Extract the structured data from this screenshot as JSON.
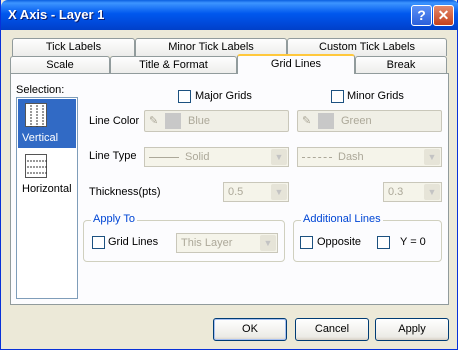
{
  "window": {
    "title": "X Axis - Layer 1",
    "help_label": "?",
    "close_label": "✕"
  },
  "tabs_row1": [
    "Tick Labels",
    "Minor Tick Labels",
    "Custom Tick Labels"
  ],
  "tabs_row2": [
    "Scale",
    "Title & Format",
    "Grid Lines",
    "Break"
  ],
  "active_tab": "Grid Lines",
  "selection": {
    "label": "Selection:",
    "items": [
      {
        "label": "Vertical",
        "selected": true
      },
      {
        "label": "Horizontal",
        "selected": false
      }
    ]
  },
  "grid": {
    "major_label": "Major Grids",
    "minor_label": "Minor Grids",
    "major_checked": false,
    "minor_checked": false,
    "line_color_label": "Line Color",
    "major_color": "Blue",
    "minor_color": "Green",
    "line_type_label": "Line Type",
    "major_type": "Solid",
    "minor_type": "Dash",
    "thickness_label": "Thickness(pts)",
    "major_thickness": "0.5",
    "minor_thickness": "0.3"
  },
  "apply_to": {
    "caption": "Apply To",
    "grid_lines_label": "Grid Lines",
    "scope_value": "This Layer"
  },
  "additional_lines": {
    "caption": "Additional Lines",
    "opposite_label": "Opposite",
    "y0_label": "Y = 0"
  },
  "buttons": {
    "ok": "OK",
    "cancel": "Cancel",
    "apply": "Apply"
  },
  "colors": {
    "title_bar": "#0058ee",
    "selection_highlight": "#316ac5",
    "active_tab_accent": "#ffc83c",
    "group_caption": "#0046d5"
  }
}
